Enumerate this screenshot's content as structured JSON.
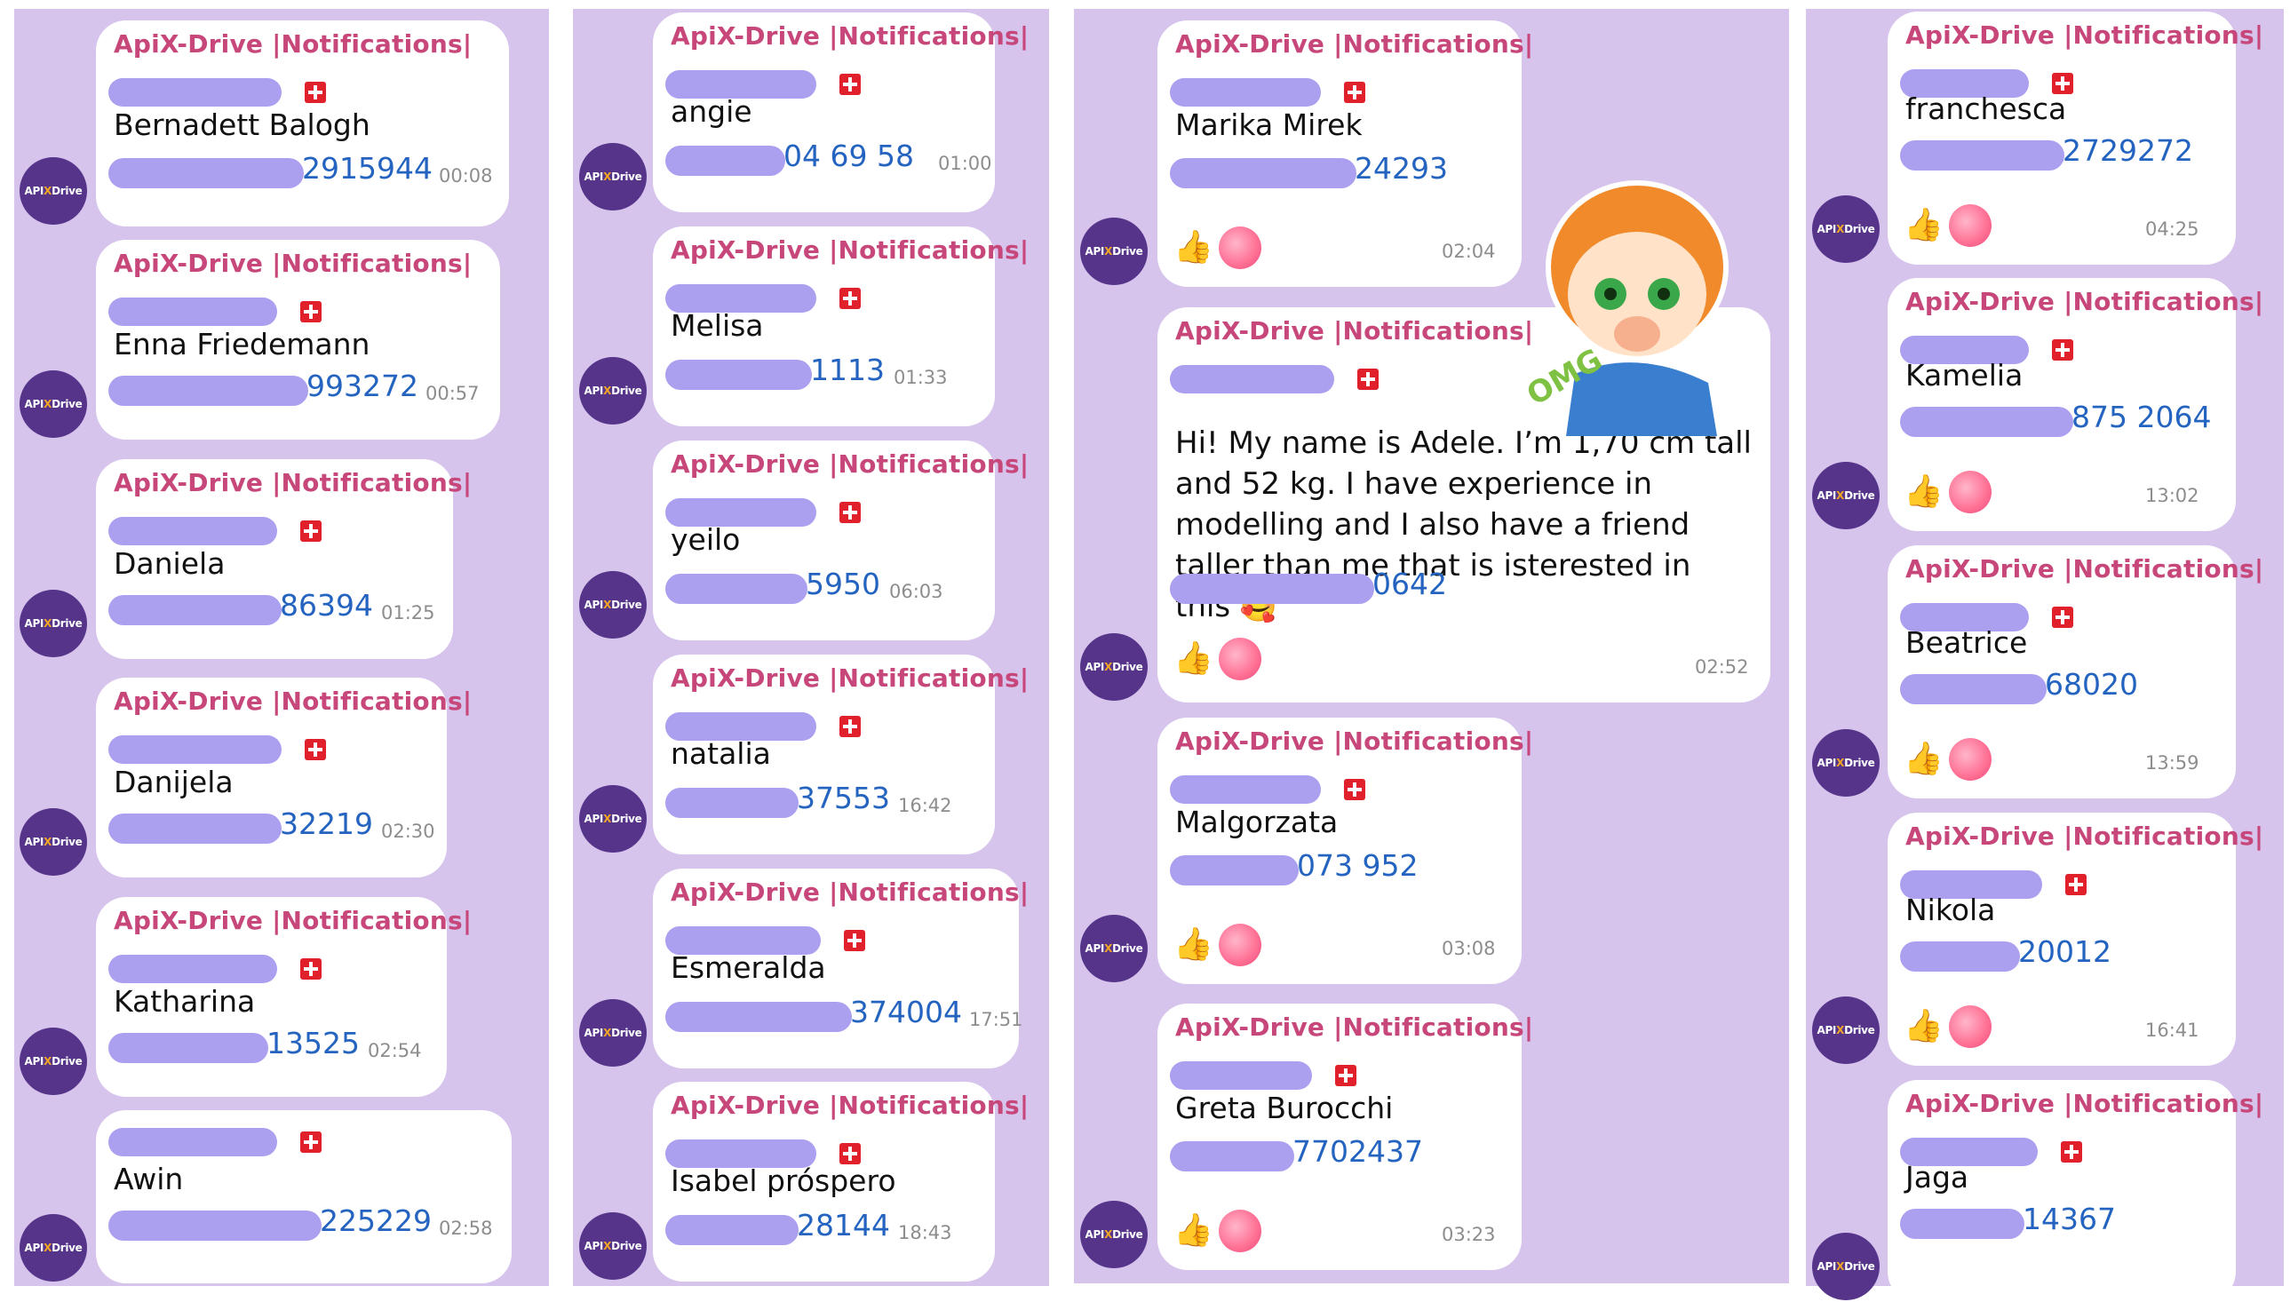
{
  "header": "ApiX-Drive |Notifications|",
  "avatar_label": "APIXDrive",
  "colors": {
    "panel": "#d6c4ec",
    "bubble": "#ffffff",
    "header": "#c7477b",
    "phone": "#2464c0",
    "redaction": "#ab9ff0",
    "avatar": "#55348a"
  },
  "columns": [
    {
      "messages": [
        {
          "name": "Bernadett Balogh",
          "phone": "2915944",
          "time": "00:08"
        },
        {
          "name": "Enna Friedemann",
          "phone": "993272",
          "time": "00:57"
        },
        {
          "name": "Daniela",
          "phone": "86394",
          "time": "01:25"
        },
        {
          "name": "Danijela",
          "phone": "32219",
          "time": "02:30"
        },
        {
          "name": "Katharina",
          "phone": "13525",
          "time": "02:54"
        },
        {
          "name": "Awin",
          "phone": "225229",
          "time": "02:58"
        }
      ]
    },
    {
      "messages": [
        {
          "name": "angie",
          "phone": "04 69 58",
          "time": "01:00"
        },
        {
          "name": "Melisa",
          "phone": "1113",
          "time": "01:33"
        },
        {
          "name": "yeilo",
          "phone": "5950",
          "time": "06:03"
        },
        {
          "name": "natalia",
          "phone": "37553",
          "time": "16:42"
        },
        {
          "name": "Esmeralda",
          "phone": "374004",
          "time": "17:51"
        },
        {
          "name": "Isabel próspero",
          "phone": "28144",
          "time": "18:43"
        }
      ]
    },
    {
      "messages": [
        {
          "name": "Marika Mirek",
          "phone": "24293",
          "time": "02:04",
          "reactions": [
            "thumbs-up",
            "peach"
          ]
        },
        {
          "text": "Hi! My name is Adele. I’m 1,70 cm tall and 52 kg. I have experience in modelling and I also have a friend taller than me that is isterested in this 🥰",
          "phone": "0642",
          "time": "02:52",
          "reactions": [
            "thumbs-up",
            "peach"
          ],
          "sticker": "OMG"
        },
        {
          "name": "Malgorzata",
          "phone": "073 952",
          "time": "03:08",
          "reactions": [
            "thumbs-up",
            "peach"
          ]
        },
        {
          "name": "Greta Burocchi",
          "phone": "7702437",
          "time": "03:23",
          "reactions": [
            "thumbs-up",
            "peach"
          ]
        }
      ]
    },
    {
      "messages": [
        {
          "name": "franchesca",
          "phone": "2729272",
          "time": "04:25",
          "reactions": [
            "thumbs-up",
            "peach"
          ]
        },
        {
          "name": "Kamelia",
          "phone": "875 2064",
          "time": "13:02",
          "reactions": [
            "thumbs-up",
            "peach"
          ]
        },
        {
          "name": "Beatrice",
          "phone": "68020",
          "time": "13:59",
          "reactions": [
            "thumbs-up",
            "peach"
          ]
        },
        {
          "name": "Nikola",
          "phone": "20012",
          "time": "16:41",
          "reactions": [
            "thumbs-up",
            "peach"
          ]
        },
        {
          "name": "Jaga",
          "phone": "14367",
          "time": ""
        }
      ]
    }
  ]
}
